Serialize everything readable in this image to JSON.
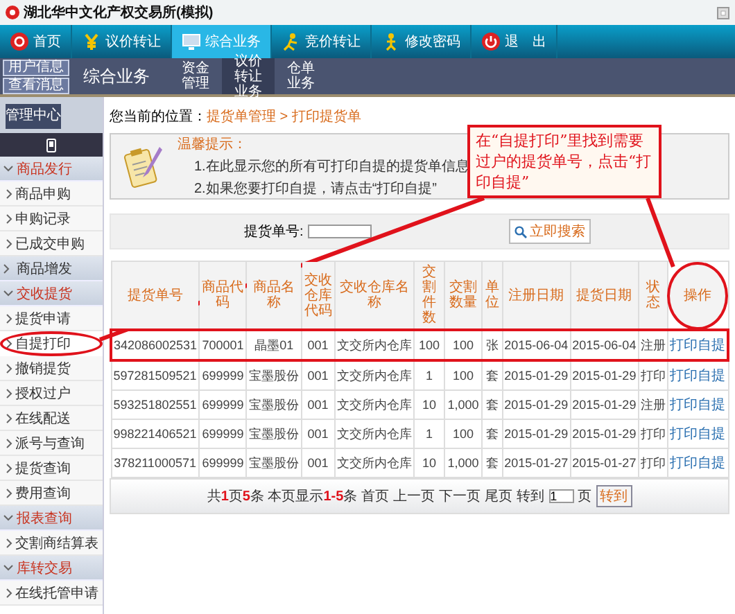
{
  "window": {
    "title": "湖北华中文化产权交易所(模拟)"
  },
  "nav": [
    {
      "label": "首页",
      "selected": false
    },
    {
      "label": "议价转让",
      "selected": false
    },
    {
      "label": "综合业务",
      "selected": true
    },
    {
      "label": "竞价转让",
      "selected": false
    },
    {
      "label": "修改密码",
      "selected": false
    },
    {
      "label": "退　出",
      "selected": false
    }
  ],
  "subbar": {
    "buttons": [
      "用户信息",
      "查看消息"
    ],
    "section": "综合业务",
    "items": [
      {
        "label": "资金管理",
        "selected": false
      },
      {
        "label": "议价转让业务",
        "selected": true
      },
      {
        "label": "仓单业务",
        "selected": false
      }
    ]
  },
  "sidebar": {
    "tab": "管理中心",
    "groups": [
      {
        "label": "商品发行",
        "expanded": true,
        "children": [
          {
            "label": "商品申购",
            "selected": false,
            "circled": false
          },
          {
            "label": "申购记录",
            "selected": false,
            "circled": false
          },
          {
            "label": "已成交申购",
            "selected": false,
            "circled": false
          }
        ]
      },
      {
        "label": "商品增发",
        "expanded": false
      },
      {
        "label": "交收提货",
        "expanded": true,
        "children": [
          {
            "label": "提货申请",
            "selected": false,
            "circled": false
          },
          {
            "label": "自提打印",
            "selected": true,
            "circled": true
          },
          {
            "label": "撤销提货",
            "selected": false,
            "circled": false
          },
          {
            "label": "授权过户",
            "selected": false,
            "circled": false
          },
          {
            "label": "在线配送",
            "selected": false,
            "circled": false
          },
          {
            "label": "派号与查询",
            "selected": false,
            "circled": false
          },
          {
            "label": "提货查询",
            "selected": false,
            "circled": false
          },
          {
            "label": "费用查询",
            "selected": false,
            "circled": false
          }
        ]
      },
      {
        "label": "报表查询",
        "expanded": true,
        "children": [
          {
            "label": "交割商结算表",
            "selected": false,
            "circled": false
          }
        ]
      },
      {
        "label": "库转交易",
        "expanded": true,
        "children": [
          {
            "label": "在线托管申请",
            "selected": false,
            "circled": false
          }
        ]
      }
    ]
  },
  "breadcrumb": {
    "prefix": "您当前的位置：",
    "path": "提货单管理 > 打印提货单"
  },
  "tip": {
    "title": "温馨提示：",
    "lines": [
      "1.在此显示您的所有可打印自提的提货单信息",
      "2.如果您要打印自提，请点击“打印自提”"
    ]
  },
  "callout": {
    "text": "在“自提打印”里找到需要过户的提货单号，点击“打印自提”"
  },
  "search": {
    "label": "提货单号:",
    "button": "立即搜索"
  },
  "table": {
    "columns": [
      {
        "label": "提货单号",
        "circled": false
      },
      {
        "label": "商品代码",
        "circled": false
      },
      {
        "label": "商品名称",
        "circled": false
      },
      {
        "label": "交收仓库代码",
        "circled": false
      },
      {
        "label": "交收仓库名称",
        "circled": false
      },
      {
        "label": "交割件数",
        "circled": false
      },
      {
        "label": "交割数量",
        "circled": false
      },
      {
        "label": "单位",
        "circled": false
      },
      {
        "label": "注册日期",
        "circled": false
      },
      {
        "label": "提货日期",
        "circled": false
      },
      {
        "label": "状态",
        "circled": false
      },
      {
        "label": "操作",
        "circled": true
      }
    ],
    "rows": [
      {
        "highlighted": true,
        "cells": [
          "342086002531",
          "700001",
          "晶墨01",
          "001",
          "文交所内仓库",
          "100",
          "100",
          "张",
          "2015-06-04",
          "2015-06-04",
          "注册"
        ],
        "action": "打印自提"
      },
      {
        "highlighted": false,
        "cells": [
          "597281509521",
          "699999",
          "宝墨股份",
          "001",
          "文交所内仓库",
          "1",
          "100",
          "套",
          "2015-01-29",
          "2015-01-29",
          "打印"
        ],
        "action": "打印自提"
      },
      {
        "highlighted": false,
        "cells": [
          "593251802551",
          "699999",
          "宝墨股份",
          "001",
          "文交所内仓库",
          "10",
          "1,000",
          "套",
          "2015-01-29",
          "2015-01-29",
          "注册"
        ],
        "action": "打印自提"
      },
      {
        "highlighted": false,
        "cells": [
          "998221406521",
          "699999",
          "宝墨股份",
          "001",
          "文交所内仓库",
          "1",
          "100",
          "套",
          "2015-01-29",
          "2015-01-29",
          "打印"
        ],
        "action": "打印自提"
      },
      {
        "highlighted": false,
        "cells": [
          "378211000571",
          "699999",
          "宝墨股份",
          "001",
          "文交所内仓库",
          "10",
          "1,000",
          "套",
          "2015-01-27",
          "2015-01-27",
          "打印"
        ],
        "action": "打印自提"
      }
    ]
  },
  "pager": {
    "summary": "共**1**页**5**条 本页显示**1-5**条",
    "links": [
      "首页",
      "上一页",
      "下一页",
      "尾页"
    ],
    "goto_label": "转到",
    "page_value": "1",
    "page_suffix": "页",
    "go_button": "转到"
  }
}
